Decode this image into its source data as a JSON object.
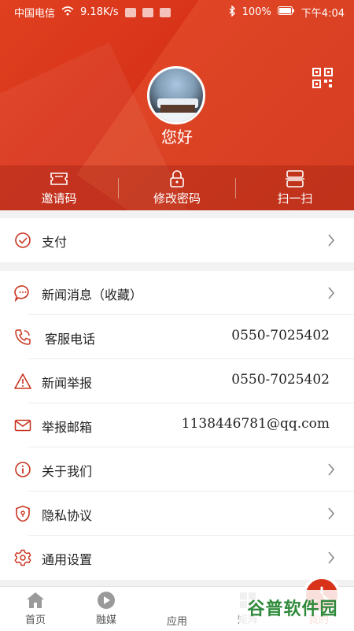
{
  "status": {
    "carrier": "中国电信",
    "speed": "9.18K/s",
    "battery": "100%",
    "time": "下午4:04"
  },
  "profile": {
    "greeting": "您好"
  },
  "actions": [
    {
      "label": "邀请码",
      "icon": "ticket-icon"
    },
    {
      "label": "修改密码",
      "icon": "lock-icon"
    },
    {
      "label": "扫一扫",
      "icon": "scan-icon"
    }
  ],
  "menu": {
    "pay": {
      "label": "支付"
    },
    "items": [
      {
        "label": "新闻消息（收藏）",
        "icon": "chat-bubble-icon",
        "value": ""
      },
      {
        "label": "客服电话",
        "icon": "phone-icon",
        "value": "0550-7025402"
      },
      {
        "label": "新闻举报",
        "icon": "warning-icon",
        "value": "0550-7025402"
      },
      {
        "label": "举报邮箱",
        "icon": "mail-icon",
        "value": "1138446781@qq.com"
      },
      {
        "label": "关于我们",
        "icon": "info-icon",
        "value": ""
      },
      {
        "label": "隐私协议",
        "icon": "privacy-shield-icon",
        "value": ""
      },
      {
        "label": "通用设置",
        "icon": "gear-icon",
        "value": ""
      }
    ]
  },
  "tabs": [
    {
      "label": "首页",
      "icon": "home-icon"
    },
    {
      "label": "融媒",
      "icon": "play-icon"
    },
    {
      "label": "应用",
      "icon": "app-center-icon"
    },
    {
      "label": "矩阵",
      "icon": "matrix-icon"
    },
    {
      "label": "我的",
      "icon": "profile-icon"
    }
  ],
  "watermark": "谷普软件园",
  "colors": {
    "accent": "#d8331a",
    "icon_red": "#c8341f"
  }
}
